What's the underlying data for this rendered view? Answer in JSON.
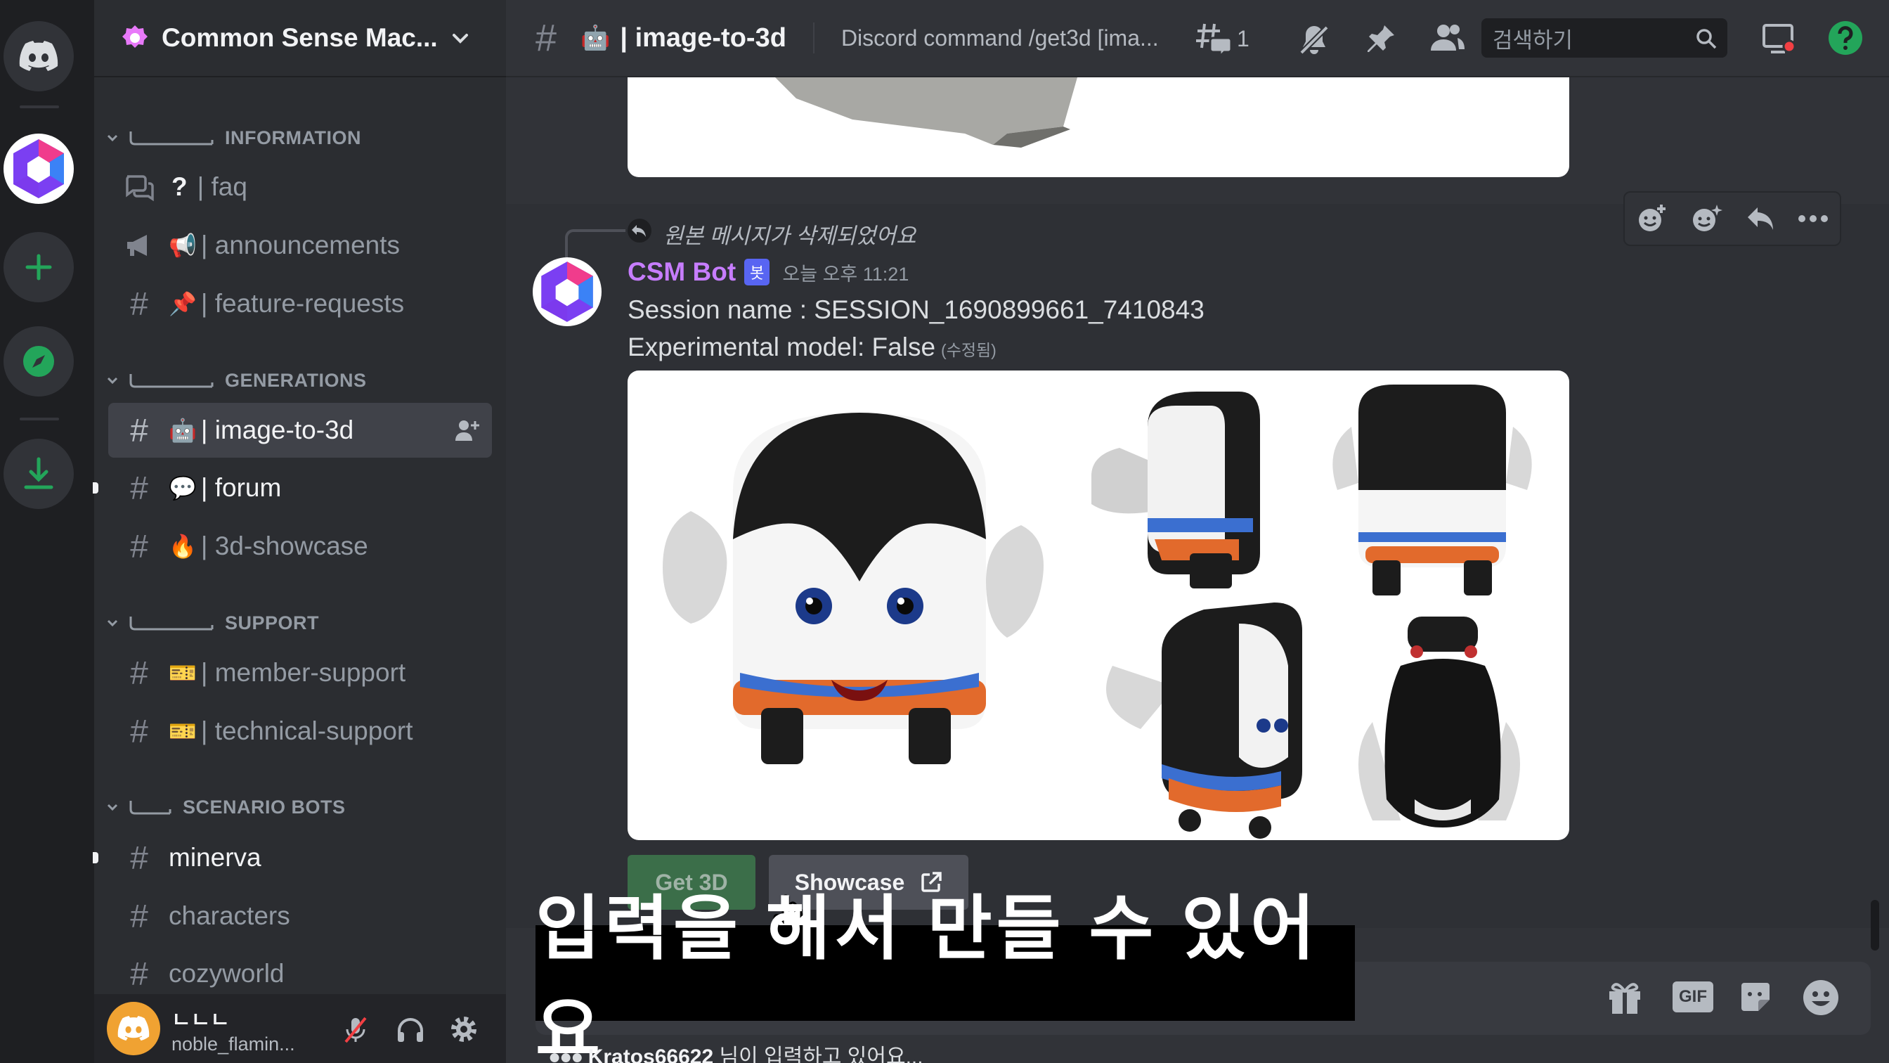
{
  "server": {
    "name": "Common Sense Mac...",
    "icons": [
      "discord-home-icon",
      "csm-server-icon",
      "add-server-icon",
      "explore-icon",
      "download-icon"
    ]
  },
  "categories": {
    "information": "INFORMATION",
    "generations": "GENERATIONS",
    "support": "SUPPORT",
    "scenario": "SCENARIO BOTS"
  },
  "channels": {
    "faq": "| faq",
    "faq_prefix": "?",
    "announcements": "| announcements",
    "feature_requests": "| feature-requests",
    "image_to_3d": "| image-to-3d",
    "forum": "| forum",
    "showcase": "| 3d-showcase",
    "member_support": "| member-support",
    "technical_support": "| technical-support",
    "minerva": "minerva",
    "characters": "characters",
    "cozyworld": "cozyworld"
  },
  "user": {
    "display": "ㄴㄴㄴ",
    "username": "noble_flamin..."
  },
  "topbar": {
    "channel": "| image-to-3d",
    "topic": "Discord command /get3d [ima...",
    "threads_count": "1",
    "search_placeholder": "검색하기"
  },
  "message": {
    "reply_text": "원본 메시지가 삭제되었어요",
    "author": "CSM Bot",
    "bot_tag": "봇",
    "time": "오늘 오후 11:21",
    "line1": "Session name : SESSION_1690899661_7410843",
    "line2": "Experimental model: False",
    "edited": "(수정됨)",
    "buttons": {
      "get3d": "Get 3D",
      "showcase": "Showcase"
    }
  },
  "subtitle": "입력을 해서 만들 수 있어요",
  "typing": {
    "user": "Kratos66622",
    "suffix": " 님이 입력하고 있어요..."
  },
  "composer_icons": [
    "gift-icon",
    "gif-icon",
    "sticker-icon",
    "emoji-icon"
  ],
  "gif_label": "GIF",
  "colors": {
    "accent": "#5865f2",
    "green": "#23a55a",
    "bot_name": "#c77dff"
  }
}
